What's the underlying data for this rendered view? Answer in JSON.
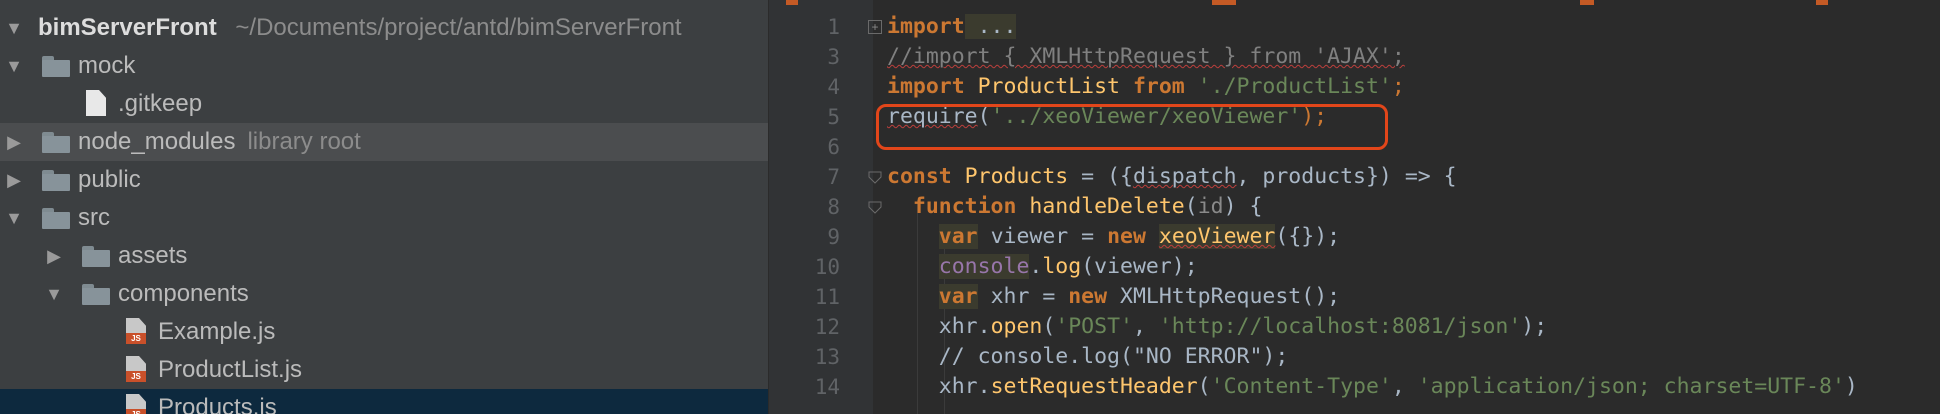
{
  "project_tree": {
    "root": {
      "name": "bimServerFront",
      "path": "~/Documents/project/antd/bimServerFront"
    },
    "items": [
      {
        "label": "mock",
        "type": "folder",
        "expanded": true
      },
      {
        "label": ".gitkeep",
        "type": "file"
      },
      {
        "label": "node_modules",
        "hint": "library root",
        "type": "folder",
        "expanded": false
      },
      {
        "label": "public",
        "type": "folder",
        "expanded": false
      },
      {
        "label": "src",
        "type": "folder",
        "expanded": true
      },
      {
        "label": "assets",
        "type": "folder",
        "expanded": false
      },
      {
        "label": "components",
        "type": "folder",
        "expanded": true
      },
      {
        "label": "Example.js",
        "type": "js-file"
      },
      {
        "label": "ProductList.js",
        "type": "js-file"
      },
      {
        "label": "Products.js",
        "type": "js-file",
        "selected": true
      }
    ],
    "js_badge": "JS",
    "arrow_expanded": "▼",
    "arrow_collapsed": "▶"
  },
  "editor": {
    "line_numbers": [
      "1",
      "3",
      "4",
      "5",
      "6",
      "7",
      "8",
      "9",
      "10",
      "11",
      "12",
      "13",
      "14"
    ],
    "fold_plus": "+",
    "lines": {
      "l1": {
        "kw": "import",
        "rest": " ..."
      },
      "l3": {
        "text": "//import { XMLHttpRequest } from 'AJAX';"
      },
      "l4": {
        "kw1": "import",
        "name": " ProductList ",
        "kw2": "from",
        "sp": " ",
        "str": "'./ProductList'",
        "end": ";"
      },
      "l5": {
        "fn": "require",
        "open": "(",
        "str": "'../xeoViewer/xeoViewer'",
        "end": ");"
      },
      "l7": {
        "kw": "const",
        "name": " Products",
        "mid": " = ({",
        "p1": "dispatch",
        "comma": ", ",
        "p2": "products",
        "end": "}) => {"
      },
      "l8": {
        "indent": "  ",
        "kw": "function",
        "name": " handleDelete",
        "open": "(",
        "param": "id",
        "end": ") {"
      },
      "l9": {
        "indent": "    ",
        "kw": "var",
        "mid": " viewer = ",
        "kw2": "new",
        "sp": " ",
        "cls": "xeoViewer",
        "end": "({});"
      },
      "l10": {
        "indent": "    ",
        "obj": "console",
        "dot": ".",
        "fn": "log",
        "end": "(viewer);"
      },
      "l11": {
        "indent": "    ",
        "kw": "var",
        "mid": " xhr = ",
        "kw2": "new",
        "cls": " XMLHttpRequest",
        "end": "();"
      },
      "l12": {
        "indent": "    ",
        "obj": "xhr.",
        "fn": "open",
        "open": "(",
        "s1": "'POST'",
        "comma": ", ",
        "s2": "'http://localhost:8081/json'",
        "end": ");"
      },
      "l13": {
        "indent": "    ",
        "cmt": "// console.log(\"NO ERROR\");"
      },
      "l14": {
        "indent": "    ",
        "obj": "xhr.",
        "fn": "setRequestHeader",
        "open": "(",
        "s1": "'Content-Type'",
        "comma": ", ",
        "s2": "'application/json; charset=UTF-8'",
        "end": ")"
      }
    }
  },
  "colors": {
    "accent_box": "#e2461a",
    "keyword": "#cc7832",
    "string": "#6a8759",
    "function": "#ffc66d"
  }
}
